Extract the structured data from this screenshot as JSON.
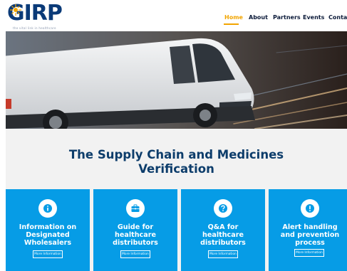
{
  "logo": {
    "text": "GIRP",
    "tagline": "the vital link in healthcare"
  },
  "nav": {
    "items": [
      {
        "label": "Home",
        "active": true
      },
      {
        "label": "About",
        "active": false
      },
      {
        "label": "Partners",
        "active": false
      },
      {
        "label": "Events",
        "active": false
      },
      {
        "label": "Contact",
        "active": false
      }
    ]
  },
  "main": {
    "headline_line1": "The Supply Chain and Medicines",
    "headline_line2": "Verification"
  },
  "cards": [
    {
      "icon": "info-icon",
      "title": [
        "Information on",
        "Designated",
        "Wholesalers"
      ],
      "button": "More Information"
    },
    {
      "icon": "briefcase-icon",
      "title": [
        "Guide for",
        "healthcare",
        "distributors"
      ],
      "button": "More Information"
    },
    {
      "icon": "question-icon",
      "title": [
        "Q&A for",
        "healthcare",
        "distributors"
      ],
      "button": "More Information"
    },
    {
      "icon": "alert-icon",
      "title": [
        "Alert handling",
        "and prevention",
        "process"
      ],
      "button": "More Information"
    }
  ],
  "colors": {
    "brand_navy": "#0a3a78",
    "accent_orange": "#f2a500",
    "card_blue": "#069ce6",
    "headline_navy": "#0d3d6b"
  }
}
